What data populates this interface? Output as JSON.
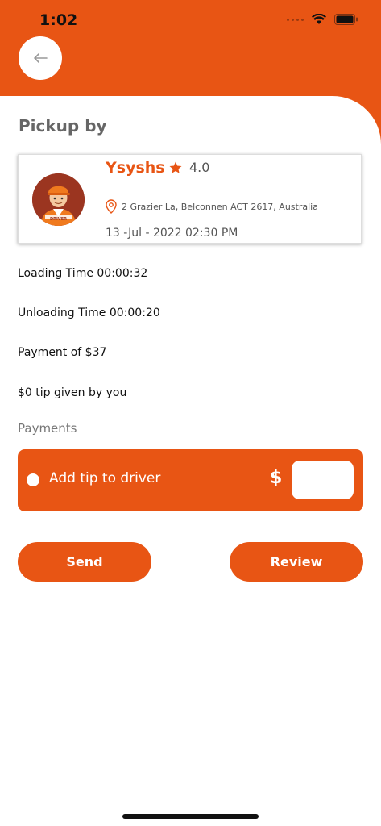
{
  "status_bar": {
    "time": "1:02"
  },
  "header": {
    "title": "Pickup by"
  },
  "driver": {
    "name": "Ysyshs",
    "rating": "4.0",
    "address": "2 Grazier La, Belconnen ACT 2617, Australia",
    "datetime": "13 -Jul - 2022 02:30 PM",
    "avatar_caption": "DRIVER"
  },
  "details": {
    "loading_time": "Loading Time 00:00:32",
    "unloading_time": "Unloading Time 00:00:20",
    "payment": "Payment of $37",
    "tip_given": "$0 tip given by you"
  },
  "payments": {
    "label": "Payments",
    "tip_label": "Add tip to driver",
    "currency_symbol": "$",
    "tip_value": "",
    "tip_placeholder": ""
  },
  "actions": {
    "send_label": "Send",
    "review_label": "Review"
  },
  "colors": {
    "accent": "#E85514",
    "star": "#E85514"
  },
  "icons": [
    "back-arrow-icon",
    "star-icon",
    "location-pin-icon",
    "wifi-icon",
    "battery-icon",
    "signal-icon"
  ]
}
